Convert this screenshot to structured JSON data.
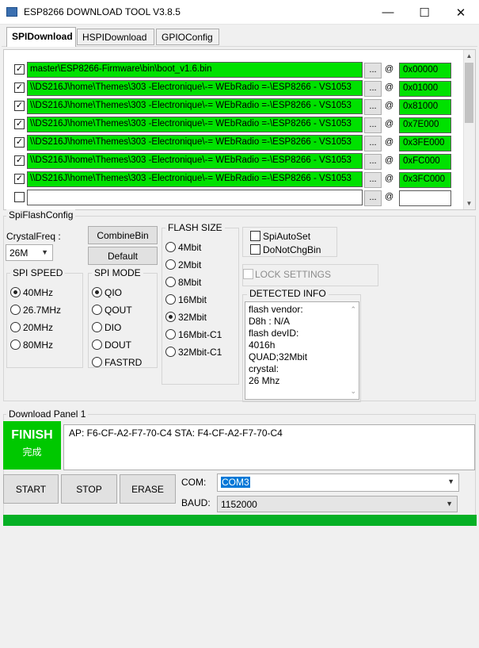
{
  "window": {
    "title": "ESP8266 DOWNLOAD TOOL V3.8.5",
    "minimize": "—",
    "maximize": "☐",
    "close": "✕"
  },
  "tabs": [
    {
      "label": "SPIDownload"
    },
    {
      "label": "HSPIDownload"
    },
    {
      "label": "GPIOConfig"
    }
  ],
  "files": [
    {
      "checked": "✓",
      "path": "master\\ESP8266-Firmware\\bin\\boot_v1.6.bin",
      "browse": "...",
      "at": "@",
      "addr": "0x00000"
    },
    {
      "checked": "✓",
      "path": "\\\\DS216J\\home\\Themes\\303 -Electronique\\-= WEbRadio =-\\ESP8266 - VS1053",
      "browse": "...",
      "at": "@",
      "addr": "0x01000"
    },
    {
      "checked": "✓",
      "path": "\\\\DS216J\\home\\Themes\\303 -Electronique\\-= WEbRadio =-\\ESP8266 - VS1053",
      "browse": "...",
      "at": "@",
      "addr": "0x81000"
    },
    {
      "checked": "✓",
      "path": "\\\\DS216J\\home\\Themes\\303 -Electronique\\-= WEbRadio =-\\ESP8266 - VS1053",
      "browse": "...",
      "at": "@",
      "addr": "0x7E000"
    },
    {
      "checked": "✓",
      "path": "\\\\DS216J\\home\\Themes\\303 -Electronique\\-= WEbRadio =-\\ESP8266 - VS1053",
      "browse": "...",
      "at": "@",
      "addr": "0x3FE000"
    },
    {
      "checked": "✓",
      "path": "\\\\DS216J\\home\\Themes\\303 -Electronique\\-= WEbRadio =-\\ESP8266 - VS1053",
      "browse": "...",
      "at": "@",
      "addr": "0xFC000"
    },
    {
      "checked": "✓",
      "path": "\\\\DS216J\\home\\Themes\\303 -Electronique\\-= WEbRadio =-\\ESP8266 - VS1053",
      "browse": "...",
      "at": "@",
      "addr": "0x3FC000"
    },
    {
      "checked": "",
      "path": "",
      "browse": "...",
      "at": "@",
      "addr": ""
    }
  ],
  "spiflash": {
    "title": "SpiFlashConfig",
    "crystal_label": "CrystalFreq :",
    "crystal_value": "26M",
    "combine_button": "CombineBin",
    "default_button": "Default",
    "spi_speed": {
      "title": "SPI SPEED",
      "options": [
        "40MHz",
        "26.7MHz",
        "20MHz",
        "80MHz"
      ],
      "selected": "40MHz"
    },
    "spi_mode": {
      "title": "SPI MODE",
      "options": [
        "QIO",
        "QOUT",
        "DIO",
        "DOUT",
        "FASTRD"
      ],
      "selected": "QIO"
    },
    "flash_size": {
      "title": "FLASH SIZE",
      "options": [
        "4Mbit",
        "2Mbit",
        "8Mbit",
        "16Mbit",
        "32Mbit",
        "16Mbit-C1",
        "32Mbit-C1"
      ],
      "selected": "32Mbit"
    },
    "spi_auto_set": "SpiAutoSet",
    "do_not_chg_bin": "DoNotChgBin",
    "lock_settings": "LOCK SETTINGS",
    "detected_title": "DETECTED INFO",
    "detected_lines": [
      "flash vendor:",
      "D8h : N/A",
      "flash devID:",
      "4016h",
      "QUAD;32Mbit",
      "crystal:",
      "26 Mhz"
    ]
  },
  "download": {
    "panel_title": "Download Panel 1",
    "status_en": "FINISH",
    "status_cn": "完成",
    "log": "AP:  F6-CF-A2-F7-70-C4  STA:  F4-CF-A2-F7-70-C4",
    "start": "START",
    "stop": "STOP",
    "erase": "ERASE",
    "com_label": "COM:",
    "com_value": "COM3",
    "baud_label": "BAUD:",
    "baud_value": "1152000",
    "progress": 1.0
  },
  "colors": {
    "green_field": "#00e100",
    "finish": "#00c800",
    "progress": "#06b025",
    "selection": "#0078d7"
  }
}
